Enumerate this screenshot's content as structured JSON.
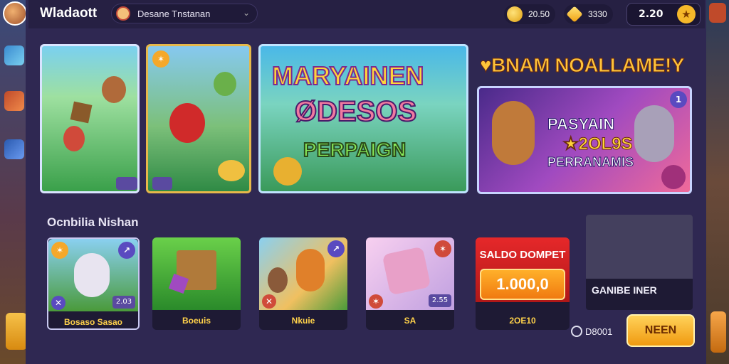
{
  "header": {
    "brand": "Wladaott",
    "search_text": "Desane Tnstanan",
    "coins_value": "20.50",
    "gems_value": "3330",
    "balance_value": "2.20",
    "add_symbol": "★"
  },
  "hero": {
    "line1": "MARYAINEN",
    "line2": "ØDESOS",
    "line3": "PERPAIGN"
  },
  "promo": {
    "headline": "♥BNAM NOALLAME!Y",
    "line1": "PASYAIN",
    "line2": "★2OL9S",
    "line3": "PERRANAMIS"
  },
  "section": {
    "title": "Ocnbilia Nishan"
  },
  "tiles": [
    {
      "label": "Bosaso Sasao",
      "chip": "2.03"
    },
    {
      "label": "Boeuis"
    },
    {
      "label": "Nkuie"
    },
    {
      "label": "SA",
      "chip": "2.55"
    }
  ],
  "wallet": {
    "title": "SALDO DOMPET",
    "value": "1.000,0",
    "label": "2OE10"
  },
  "game_tile": {
    "label": "GANIBE INER"
  },
  "footer": {
    "counter": "D8001",
    "cta": "NEEN"
  },
  "colors": {
    "accent": "#f5b82a",
    "panel": "#2f2852",
    "wallet_red": "#e6282a"
  }
}
